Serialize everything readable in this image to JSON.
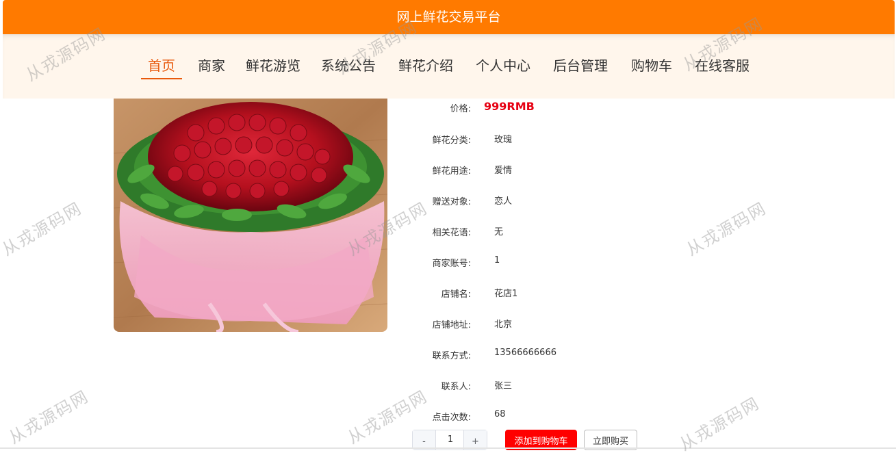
{
  "header": {
    "title": "网上鲜花交易平台"
  },
  "nav": {
    "items": [
      {
        "label": "首页",
        "active": true
      },
      {
        "label": "商家"
      },
      {
        "label": "鲜花游览"
      },
      {
        "label": "系统公告"
      },
      {
        "label": "鲜花介绍"
      },
      {
        "label": "个人中心"
      },
      {
        "label": "后台管理"
      },
      {
        "label": "购物车"
      },
      {
        "label": "在线客服"
      }
    ]
  },
  "product": {
    "price": {
      "label": "价格:",
      "value": "999RMB"
    },
    "fields": [
      {
        "label": "鲜花分类:",
        "value": "玫瑰"
      },
      {
        "label": "鲜花用途:",
        "value": "爱情"
      },
      {
        "label": "赠送对象:",
        "value": "恋人"
      },
      {
        "label": "相关花语:",
        "value": "无"
      },
      {
        "label": "商家账号:",
        "value": "1"
      },
      {
        "label": "店铺名:",
        "value": "花店1"
      },
      {
        "label": "店铺地址:",
        "value": "北京"
      },
      {
        "label": "联系方式:",
        "value": "13566666666"
      },
      {
        "label": "联系人:",
        "value": "张三"
      },
      {
        "label": "点击次数:",
        "value": "68"
      }
    ]
  },
  "actions": {
    "quantity": "1",
    "minus": "-",
    "plus": "+",
    "add_to_cart": "添加到购物车",
    "buy_now": "立即购买"
  },
  "watermark": "从戎源码网",
  "colors": {
    "header_bg": "#ff7a00",
    "nav_bg": "#fff6ec",
    "nav_active": "#e8590c",
    "price": "#e60012",
    "cart_button": "#ff0000"
  }
}
